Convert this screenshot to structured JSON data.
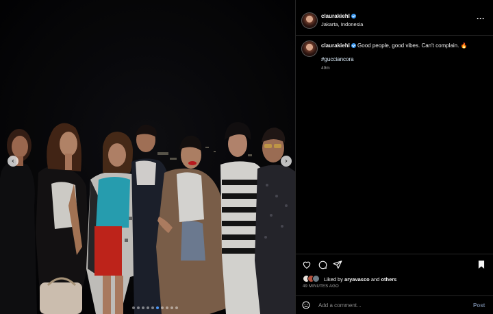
{
  "post": {
    "username": "claurakiehl",
    "location": "Jakarta, Indonesia",
    "caption": "Good people, good vibes. Can't complain. 🔥",
    "hashtag": "#gucciancora",
    "caption_time": "49m",
    "liked_by_prefix": "Liked by ",
    "liked_by_user": "aryavasco",
    "liked_by_and": " and ",
    "liked_by_others": "others",
    "timestamp": "49 MINUTES AGO"
  },
  "carousel": {
    "prev_glyph": "‹",
    "next_glyph": "›",
    "slide_count": 10,
    "active_slide": 5
  },
  "composer": {
    "placeholder": "Add a comment...",
    "post_label": "Post"
  },
  "icons": {
    "more": "more-options-icon",
    "like": "heart-icon",
    "comment": "comment-icon",
    "share": "share-icon",
    "save": "bookmark-icon",
    "emoji": "emoji-icon"
  },
  "colors": {
    "background": "#000000",
    "verified": "#3897f0",
    "hashtag": "#e0f1ff",
    "divider": "#262626"
  }
}
